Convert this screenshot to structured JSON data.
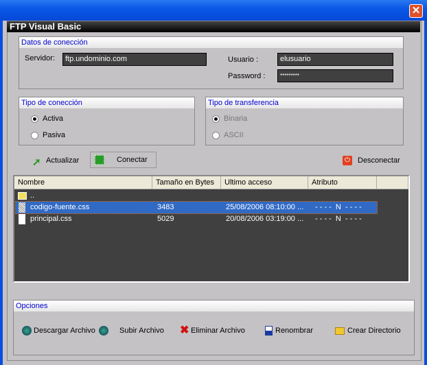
{
  "window": {
    "title": "FTP Visual Basic",
    "close": "✕"
  },
  "conexion": {
    "title": "Datos de conección",
    "servidor_label": "Servidor:",
    "servidor": "ftp.undominio.com",
    "usuario_label": "Usuario :",
    "usuario": "elusuario",
    "password_label": "Password :",
    "password": "*********"
  },
  "tipo_conexion": {
    "title": "Tipo de conección",
    "options": [
      {
        "label": "Activa",
        "checked": true
      },
      {
        "label": "Pasiva",
        "checked": false
      }
    ]
  },
  "tipo_transferencia": {
    "title": "Tipo de transferencia",
    "options": [
      {
        "label": "Binaria",
        "checked": true
      },
      {
        "label": "ASCII",
        "checked": false
      }
    ]
  },
  "toolbar": {
    "actualizar": "Actualizar",
    "conectar": "Conectar",
    "desconectar": "Desconectar"
  },
  "files": {
    "columns": [
      "Nombre",
      "Tamaño en Bytes",
      "Ultimo acceso",
      "Atributo"
    ],
    "rows": [
      {
        "name": "..",
        "size": "",
        "date": "",
        "attr": "",
        "type": "folder"
      },
      {
        "name": "codigo-fuente.css",
        "size": "3483",
        "date": "25/08/2006 08:10:00 ...",
        "attr": "- - - -  N  - - - -",
        "type": "file",
        "selected": true
      },
      {
        "name": "principal.css",
        "size": "5029",
        "date": "20/08/2006 03:19:00 ...",
        "attr": "- - - -  N  - - - -",
        "type": "file"
      }
    ]
  },
  "opciones": {
    "title": "Opciones",
    "descargar": "Descargar Archivo",
    "subir": "Subir Archivo",
    "eliminar": "Eliminar Archivo",
    "renombrar": "Renombrar",
    "crear": "Crear Directorio"
  }
}
